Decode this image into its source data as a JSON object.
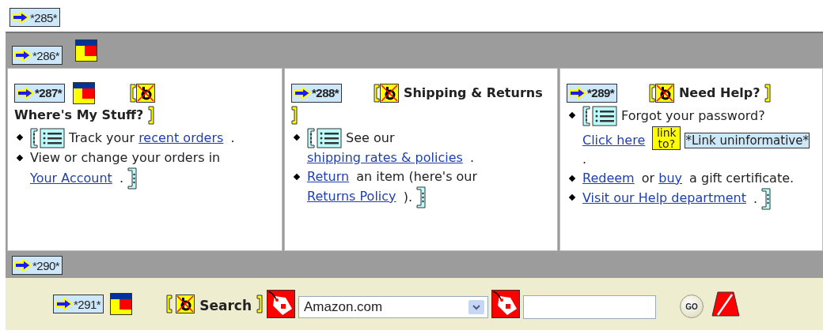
{
  "top_anchor": "*285*",
  "main_panel": {
    "anchor": "*286*",
    "layout_marker": true,
    "columns": [
      {
        "anchor": "*287*",
        "layout_marker": true,
        "heading": "Where's My Stuff?",
        "items": [
          {
            "parts": [
              {
                "kind": "text",
                "text": "Track your"
              },
              {
                "kind": "link",
                "text": "recent orders"
              },
              {
                "kind": "text",
                "text": "."
              }
            ]
          },
          {
            "parts": [
              {
                "kind": "text",
                "text": "View or change your orders in"
              },
              {
                "kind": "link",
                "text": "Your Account"
              },
              {
                "kind": "text",
                "text": "."
              }
            ]
          }
        ]
      },
      {
        "anchor": "*288*",
        "layout_marker": false,
        "heading": "Shipping & Returns",
        "items": [
          {
            "parts": [
              {
                "kind": "text",
                "text": "See our"
              },
              {
                "kind": "link",
                "text": "shipping rates & policies"
              },
              {
                "kind": "text",
                "text": "."
              }
            ]
          },
          {
            "parts": [
              {
                "kind": "link",
                "text": "Return"
              },
              {
                "kind": "text",
                "text": "an item (here's our"
              },
              {
                "kind": "link",
                "text": "Returns Policy"
              },
              {
                "kind": "text",
                "text": ")."
              }
            ]
          }
        ]
      },
      {
        "anchor": "*289*",
        "layout_marker": false,
        "heading": "Need Help?",
        "items": [
          {
            "parts": [
              {
                "kind": "text",
                "text": "Forgot your password?"
              },
              {
                "kind": "link",
                "text": "Click here"
              },
              {
                "kind": "flag",
                "text": "link to?"
              },
              {
                "kind": "note",
                "text": "*Link uninformative*"
              },
              {
                "kind": "text",
                "text": "."
              }
            ]
          },
          {
            "parts": [
              {
                "kind": "link",
                "text": "Redeem"
              },
              {
                "kind": "text",
                "text": "or"
              },
              {
                "kind": "link",
                "text": "buy"
              },
              {
                "kind": "text",
                "text": "a gift certificate."
              }
            ]
          },
          {
            "parts": [
              {
                "kind": "link",
                "text": "Visit our Help department"
              },
              {
                "kind": "text",
                "text": "."
              }
            ]
          }
        ]
      }
    ]
  },
  "search_panel": {
    "anchor": "*290*",
    "row_anchor": "*291*",
    "layout_marker": true,
    "heading": "Search",
    "select": {
      "value": "Amazon.com"
    },
    "go_button": "GO"
  }
}
